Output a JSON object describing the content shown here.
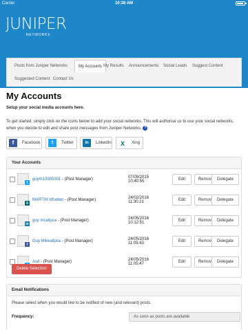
{
  "status_bar": {
    "carrier": "Carrier",
    "time": "10:38 AM",
    "battery_level": 0.85
  },
  "brand": {
    "name": "JUNIPER",
    "tagline": "NETWORKS"
  },
  "nav": {
    "tabs": [
      {
        "label": "Posts from Juniper Networks",
        "active": false
      },
      {
        "label": "My Accounts",
        "active": true
      },
      {
        "label": "My Results",
        "active": false
      },
      {
        "label": "Announcements",
        "active": false
      },
      {
        "label": "Social Leads",
        "active": false
      },
      {
        "label": "Suggest Content",
        "active": false
      },
      {
        "label": "Suggested Content",
        "active": false
      },
      {
        "label": "Contact Us",
        "active": false
      }
    ]
  },
  "page": {
    "title": "My Accounts",
    "subheading": "Setup your social media accounts here.",
    "intro": "To get started, simply click on the icons below to add your social networks. This will authorise us to use your social networks, when you decide to edit and share post messages from Juniper Networks.",
    "help_icon": "?"
  },
  "social_buttons": [
    {
      "label": "Facebook",
      "icon": "facebook-icon",
      "glyph": "f"
    },
    {
      "label": "Twitter",
      "icon": "twitter-icon",
      "glyph": "t"
    },
    {
      "label": "LinkedIn",
      "icon": "linkedin-icon",
      "glyph": "in"
    },
    {
      "label": "Xing",
      "icon": "xing-icon",
      "glyph": "X"
    }
  ],
  "accounts_panel": {
    "heading": "Your Accounts",
    "rows": [
      {
        "name": "guym13905301",
        "role": " - (Post Manager)",
        "date": "07/09/2015",
        "time": "10:40:55",
        "network": "twitter",
        "badge": "t"
      },
      {
        "name": "MARTIN Wratten",
        "role": " - (Post Manager)",
        "date": "24/02/2016",
        "time": "11:30:21",
        "network": "xing",
        "badge": "X"
      },
      {
        "name": "guy mcallpca",
        "role": " - (Post Manager)",
        "date": "24/05/2016",
        "time": "10:12:51",
        "network": "linkedin",
        "badge": "in"
      },
      {
        "name": "Guy Mikeallpca",
        "role": " - (Post Manager)",
        "date": "24/05/2016",
        "time": "11:05:43",
        "network": "facebook",
        "badge": "f"
      },
      {
        "name": "Asd",
        "role": " - (Post Manager)",
        "date": "24/05/2016",
        "time": "11:05:47",
        "network": "twitter",
        "badge": "t"
      }
    ],
    "edit_label": "Edit",
    "remove_label": "Remove",
    "delegate_label": "Delegate",
    "delete_selection_label": "Delete Selection"
  },
  "notifications_panel": {
    "heading": "Email Notifications",
    "text": "Please select when you would like to be notified of new (and relevant) posts.",
    "frequency_label": "Frequency:",
    "frequency_value": "As soon as posts are available"
  },
  "colors": {
    "brand_blue": "#1e87c9",
    "link_blue": "#1e6fb8",
    "danger_red": "#d9534f",
    "twitter": "#1da1f2",
    "xing": "#006567",
    "linkedin": "#0e76a8",
    "facebook": "#3b5998"
  }
}
